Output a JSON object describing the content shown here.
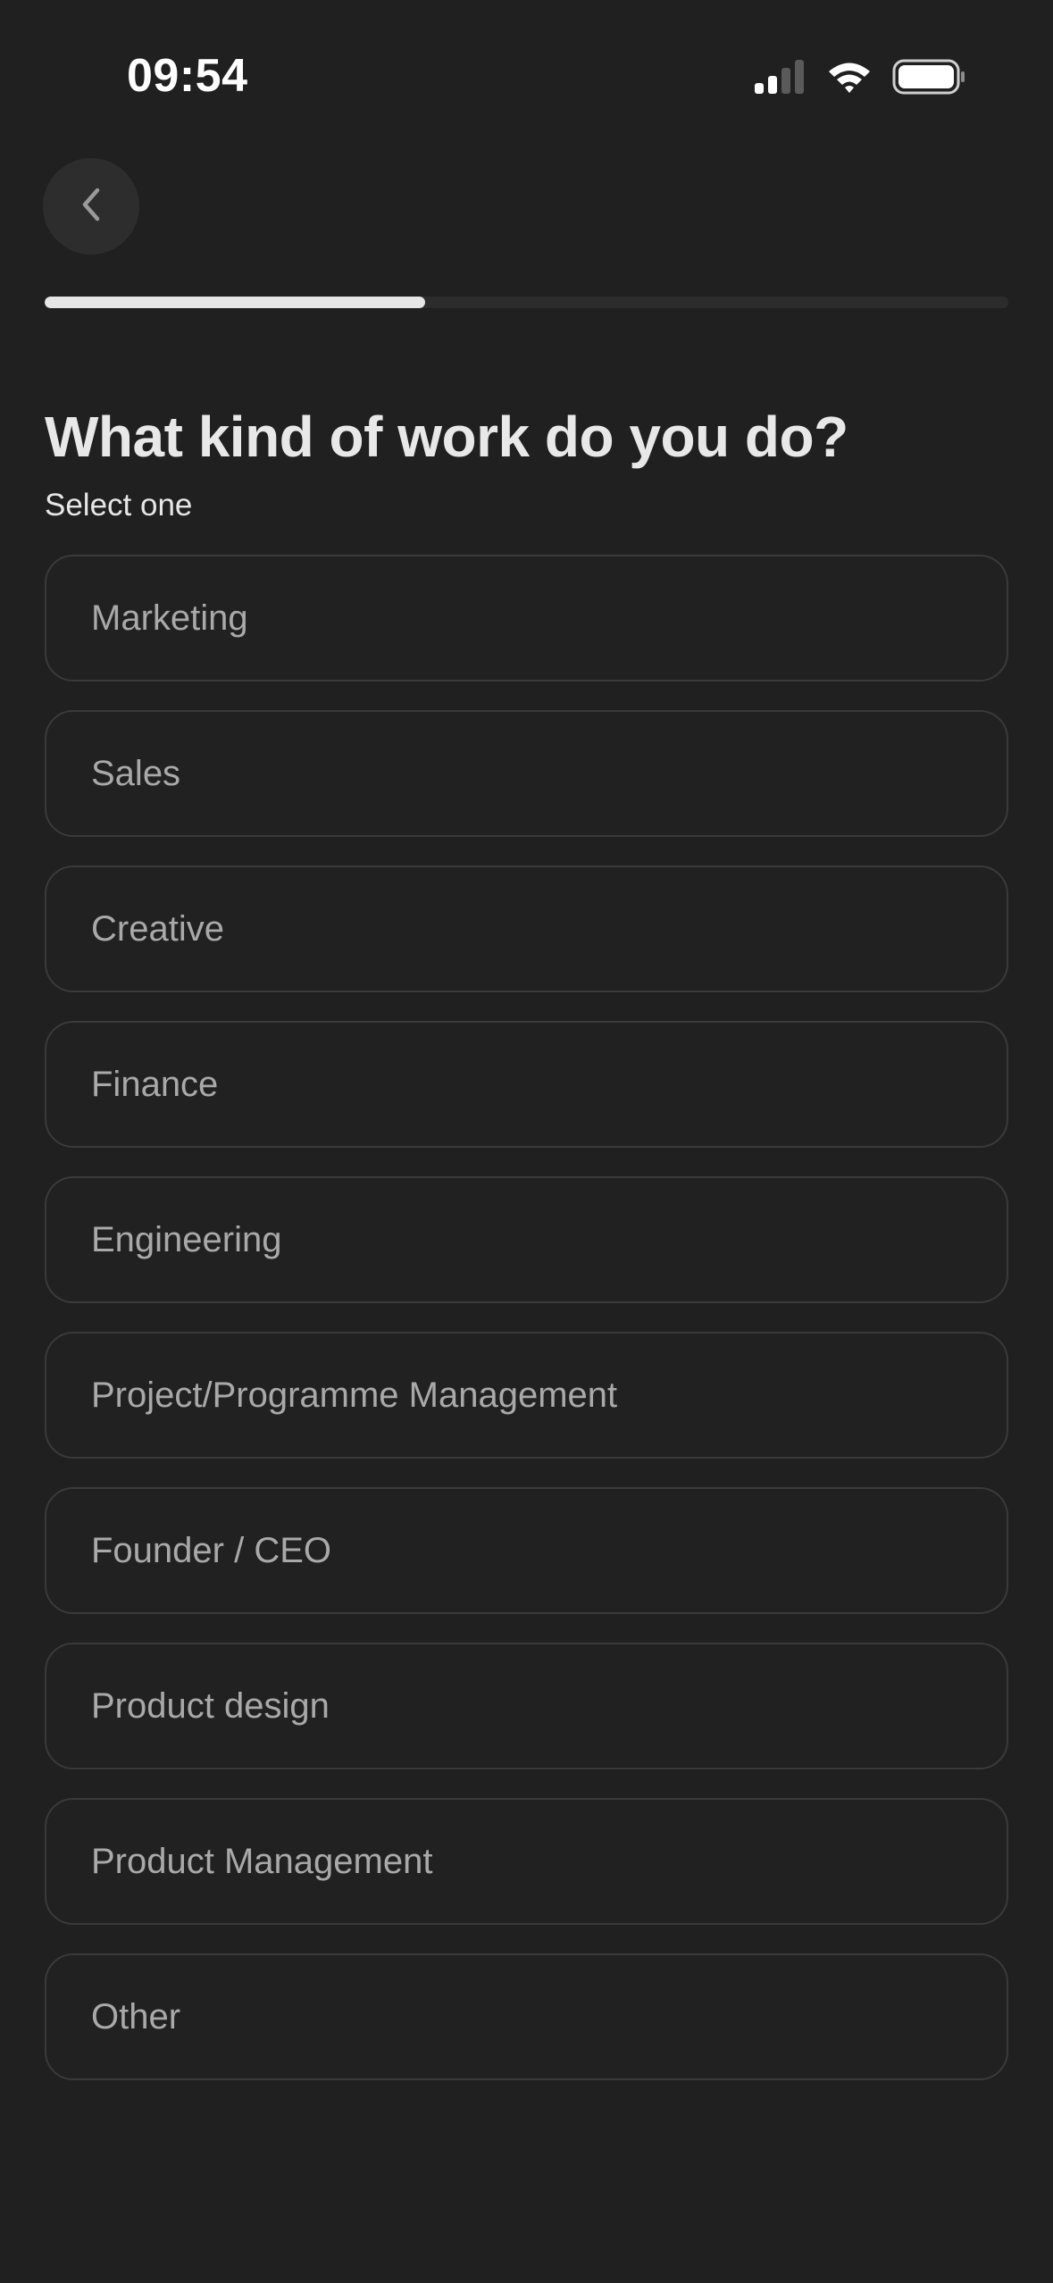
{
  "status_bar": {
    "time": "09:54",
    "icons": [
      "cellular-signal-icon",
      "wifi-icon",
      "battery-icon"
    ]
  },
  "nav": {
    "back_icon": "chevron-left-icon"
  },
  "progress": {
    "fraction": 0.395
  },
  "question": {
    "title": "What kind of work do you do?",
    "subtitle": "Select one"
  },
  "options": [
    {
      "label": "Marketing"
    },
    {
      "label": "Sales"
    },
    {
      "label": "Creative"
    },
    {
      "label": "Finance"
    },
    {
      "label": "Engineering"
    },
    {
      "label": "Project/Programme Management"
    },
    {
      "label": "Founder / CEO"
    },
    {
      "label": "Product design"
    },
    {
      "label": "Product Management"
    },
    {
      "label": "Other"
    }
  ],
  "colors": {
    "background": "#202020",
    "option_border": "#3a3a3a",
    "option_text": "#a9a9a9",
    "progress_fill": "#e6e6e6",
    "progress_track": "#2c2c2c"
  }
}
